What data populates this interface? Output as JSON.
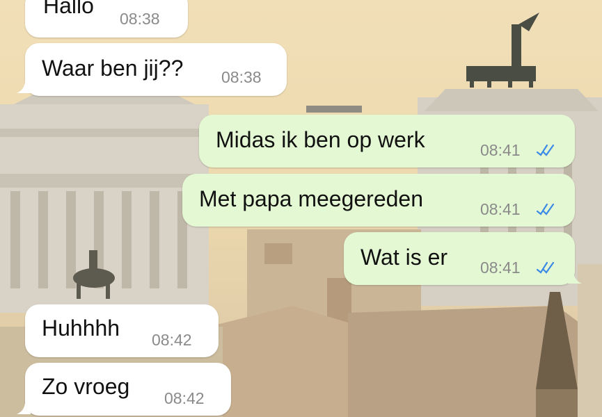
{
  "chat": {
    "messages": [
      {
        "direction": "incoming",
        "text": "Hallo",
        "time": "08:38"
      },
      {
        "direction": "incoming",
        "text": "Waar ben jij??",
        "time": "08:38"
      },
      {
        "direction": "outgoing",
        "text": "Midas ik ben op werk",
        "time": "08:41",
        "status": "read"
      },
      {
        "direction": "outgoing",
        "text": "Met papa meegereden",
        "time": "08:41",
        "status": "read"
      },
      {
        "direction": "outgoing",
        "text": "Wat is er",
        "time": "08:41",
        "status": "read"
      },
      {
        "direction": "incoming",
        "text": "Huhhhh",
        "time": "08:42"
      },
      {
        "direction": "incoming",
        "text": "Zo vroeg",
        "time": "08:42"
      }
    ]
  },
  "colors": {
    "incoming_bubble": "#ffffff",
    "outgoing_bubble": "#e3f8d3",
    "read_ticks": "#3b8ae6",
    "time_text": "#8a8a8a"
  },
  "icons": {
    "read_receipt": "double-check-icon"
  }
}
